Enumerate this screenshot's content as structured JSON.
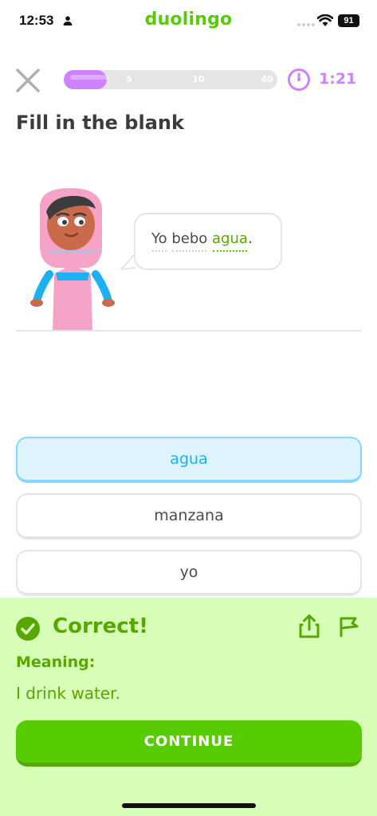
{
  "status_bar": {
    "time": "12:53",
    "app_brand": "duolingo",
    "battery": "91"
  },
  "header": {
    "progress": 0.2,
    "milestones": [
      "5",
      "10",
      "40"
    ],
    "timer": "1:21"
  },
  "lesson": {
    "title": "Fill in the blank",
    "sentence_words": [
      "Yo",
      "bebo",
      "agua",
      "."
    ],
    "answer_word_index": 2
  },
  "options": [
    {
      "label": "agua",
      "selected": true
    },
    {
      "label": "manzana",
      "selected": false
    },
    {
      "label": "yo",
      "selected": false
    }
  ],
  "feedback": {
    "title": "Correct!",
    "meaning_label": "Meaning:",
    "meaning_text": "I drink water.",
    "continue_label": "CONTINUE"
  },
  "colors": {
    "brand_green": "#58cc02",
    "dark_green": "#58a700",
    "feedback_bg": "#d7ffb8",
    "progress_purple": "#ce82ff",
    "selected_blue": "#1cb0f6",
    "selected_bg": "#ddf4ff"
  },
  "icons": [
    "person-icon",
    "signal-icon",
    "wifi-icon",
    "close-icon",
    "timer-icon",
    "check-circle-icon",
    "share-icon",
    "report-flag-icon"
  ]
}
